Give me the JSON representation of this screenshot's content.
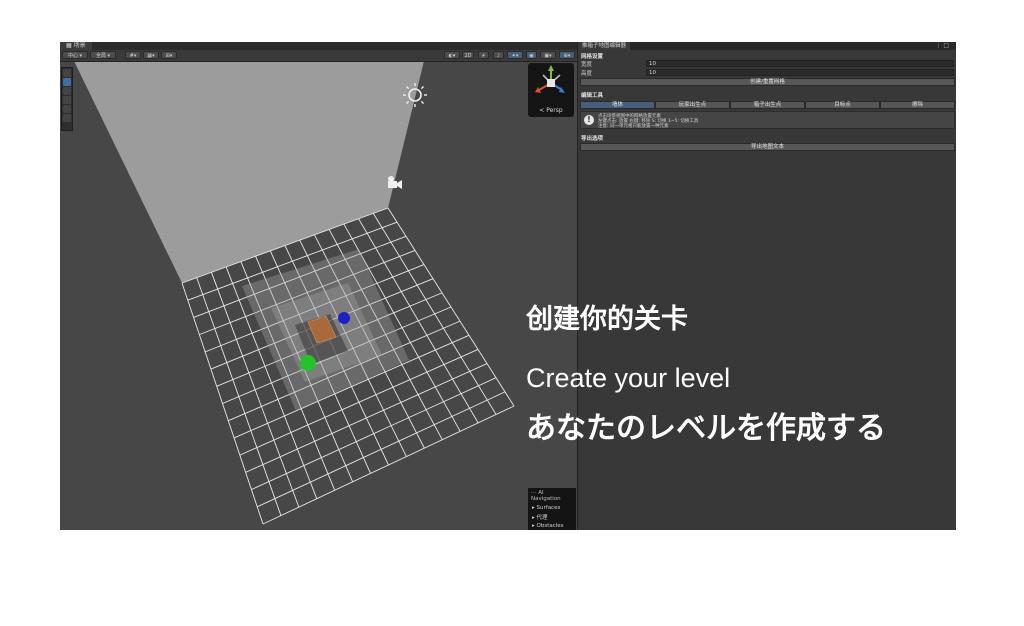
{
  "scene": {
    "tab_title": "场景",
    "toolbar": {
      "pivot": "中心",
      "space": "全局",
      "mode_2d": "2D"
    },
    "gizmo": {
      "label": "< Persp"
    },
    "ai_navigation": {
      "title": "AI Navigation",
      "items": [
        "Surfaces",
        "代理",
        "Obstacles"
      ]
    }
  },
  "overlay": {
    "title_zh": "创建你的关卡",
    "title_en": "Create your level",
    "title_ja": "あなたのレベルを作成する"
  },
  "panel": {
    "tab_title": "推箱子地图编辑器",
    "grid_section": "网格设置",
    "width_label": "宽度",
    "width_value": "10",
    "height_label": "高度",
    "height_value": "10",
    "create_grid_button": "创建/重置网格",
    "edit_section": "编辑工具",
    "modes": [
      "墙体",
      "玩家出生点",
      "箱子出生点",
      "目标点",
      "擦除"
    ],
    "active_mode": "墙体",
    "help_lines": [
      "点击场景视图中的网格放置元素",
      "左键点击: 放置  右键: 移除  S: 切换  1~5: 切换工具",
      "注意: 同一单元格只能放置一种元素"
    ],
    "export_section": "导出选项",
    "export_button": "导出地图文本"
  },
  "colors": {
    "player": "#22c42a",
    "target": "#1f1fc8",
    "box": "#a86a3a",
    "accent": "#46607c"
  }
}
